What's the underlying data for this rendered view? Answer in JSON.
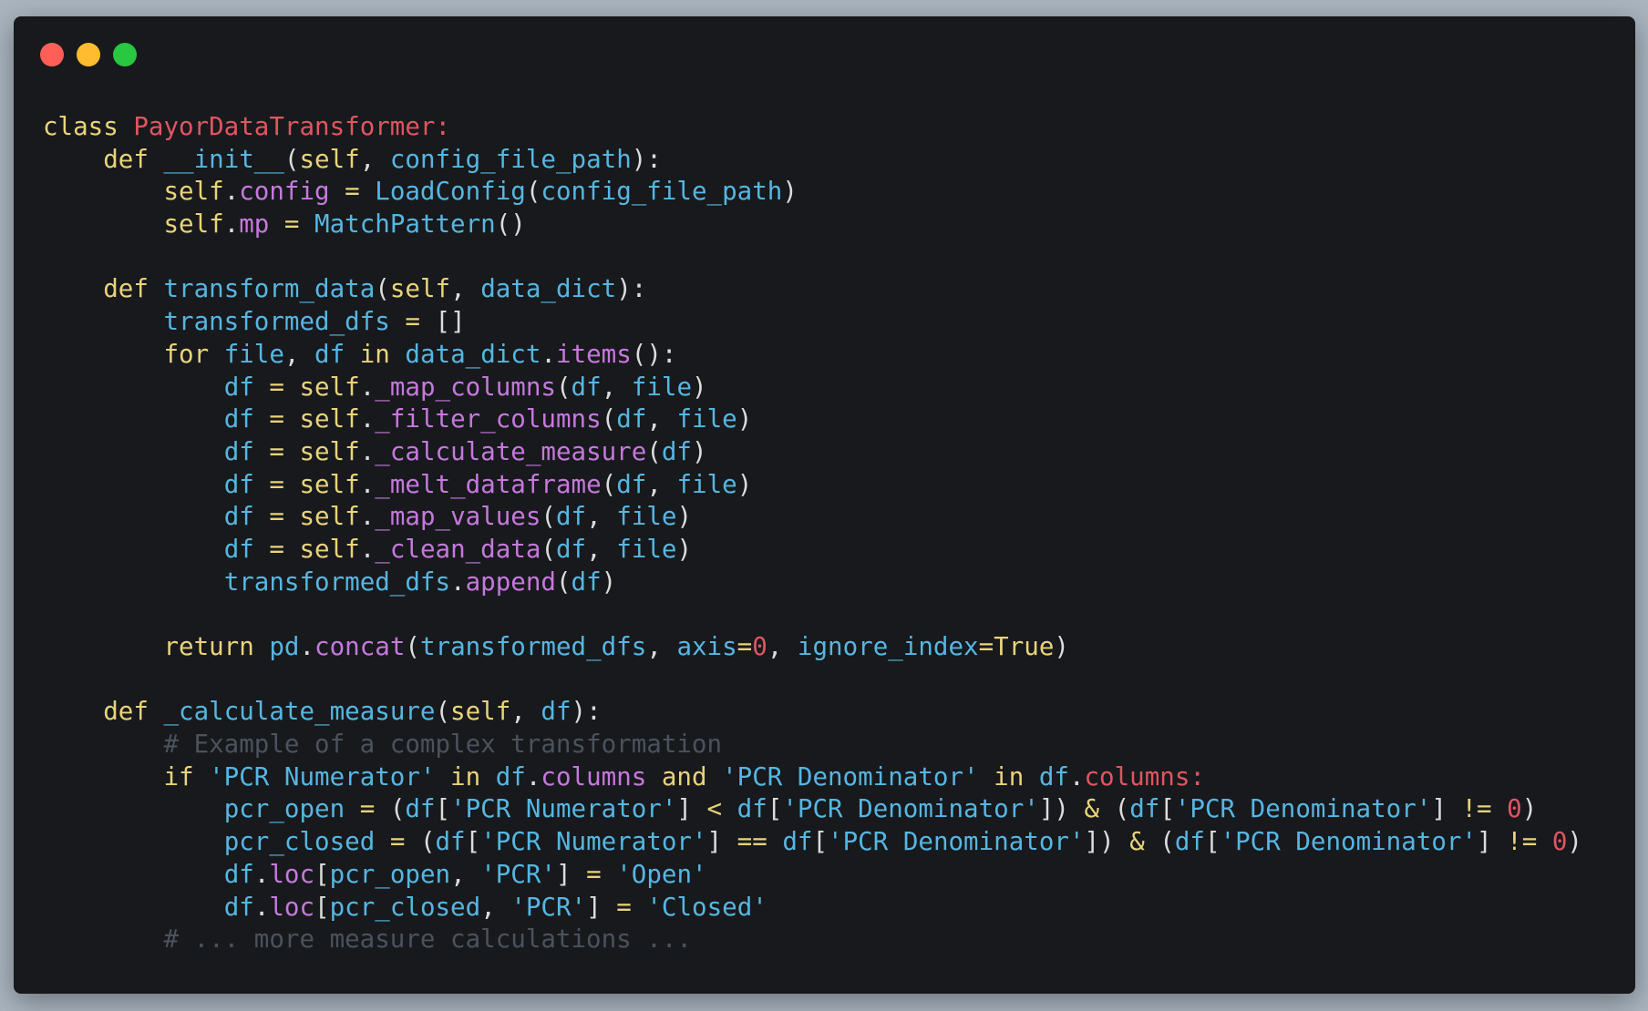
{
  "window": {
    "controls": [
      {
        "name": "close",
        "color": "#ff5f57"
      },
      {
        "name": "minimize",
        "color": "#febc2e"
      },
      {
        "name": "maximize",
        "color": "#28c840"
      }
    ]
  },
  "theme": {
    "keyword": "#e9d37a",
    "class_name": "#e05561",
    "function": "#56b6e2",
    "identifier": "#56b6e2",
    "attribute": "#c678dd",
    "punctuation": "#dcdcdc",
    "operator": "#e9d37a",
    "string": "#56b6e2",
    "number": "#e05561",
    "comment": "#4b525d",
    "default": "#e6e6e6"
  },
  "code_lines": [
    {
      "indent": 0,
      "tokens": [
        [
          "class ",
          "keyword"
        ],
        [
          "PayorDataTransformer:",
          "class_name"
        ]
      ]
    },
    {
      "indent": 4,
      "tokens": [
        [
          "def ",
          "keyword"
        ],
        [
          "__init__",
          "function"
        ],
        [
          "(",
          "punctuation"
        ],
        [
          "self",
          "keyword"
        ],
        [
          ", ",
          "punctuation"
        ],
        [
          "config_file_path",
          "identifier"
        ],
        [
          "):",
          "punctuation"
        ]
      ]
    },
    {
      "indent": 8,
      "tokens": [
        [
          "self",
          "keyword"
        ],
        [
          ".",
          "punctuation"
        ],
        [
          "config",
          "attribute"
        ],
        [
          " = ",
          "operator"
        ],
        [
          "LoadConfig",
          "function"
        ],
        [
          "(",
          "punctuation"
        ],
        [
          "config_file_path",
          "identifier"
        ],
        [
          ")",
          "punctuation"
        ]
      ]
    },
    {
      "indent": 8,
      "tokens": [
        [
          "self",
          "keyword"
        ],
        [
          ".",
          "punctuation"
        ],
        [
          "mp",
          "attribute"
        ],
        [
          " = ",
          "operator"
        ],
        [
          "MatchPattern",
          "function"
        ],
        [
          "()",
          "punctuation"
        ]
      ]
    },
    {
      "indent": 0,
      "tokens": []
    },
    {
      "indent": 4,
      "tokens": [
        [
          "def ",
          "keyword"
        ],
        [
          "transform_data",
          "function"
        ],
        [
          "(",
          "punctuation"
        ],
        [
          "self",
          "keyword"
        ],
        [
          ", ",
          "punctuation"
        ],
        [
          "data_dict",
          "identifier"
        ],
        [
          "):",
          "punctuation"
        ]
      ]
    },
    {
      "indent": 8,
      "tokens": [
        [
          "transformed_dfs",
          "identifier"
        ],
        [
          " = ",
          "operator"
        ],
        [
          "[]",
          "punctuation"
        ]
      ]
    },
    {
      "indent": 8,
      "tokens": [
        [
          "for ",
          "keyword"
        ],
        [
          "file",
          "identifier"
        ],
        [
          ", ",
          "punctuation"
        ],
        [
          "df",
          "identifier"
        ],
        [
          " in ",
          "keyword"
        ],
        [
          "data_dict",
          "identifier"
        ],
        [
          ".",
          "punctuation"
        ],
        [
          "items",
          "attribute"
        ],
        [
          "():",
          "punctuation"
        ]
      ]
    },
    {
      "indent": 12,
      "tokens": [
        [
          "df",
          "identifier"
        ],
        [
          " = ",
          "operator"
        ],
        [
          "self",
          "keyword"
        ],
        [
          ".",
          "punctuation"
        ],
        [
          "_map_columns",
          "attribute"
        ],
        [
          "(",
          "punctuation"
        ],
        [
          "df",
          "identifier"
        ],
        [
          ", ",
          "punctuation"
        ],
        [
          "file",
          "identifier"
        ],
        [
          ")",
          "punctuation"
        ]
      ]
    },
    {
      "indent": 12,
      "tokens": [
        [
          "df",
          "identifier"
        ],
        [
          " = ",
          "operator"
        ],
        [
          "self",
          "keyword"
        ],
        [
          ".",
          "punctuation"
        ],
        [
          "_filter_columns",
          "attribute"
        ],
        [
          "(",
          "punctuation"
        ],
        [
          "df",
          "identifier"
        ],
        [
          ", ",
          "punctuation"
        ],
        [
          "file",
          "identifier"
        ],
        [
          ")",
          "punctuation"
        ]
      ]
    },
    {
      "indent": 12,
      "tokens": [
        [
          "df",
          "identifier"
        ],
        [
          " = ",
          "operator"
        ],
        [
          "self",
          "keyword"
        ],
        [
          ".",
          "punctuation"
        ],
        [
          "_calculate_measure",
          "attribute"
        ],
        [
          "(",
          "punctuation"
        ],
        [
          "df",
          "identifier"
        ],
        [
          ")",
          "punctuation"
        ]
      ]
    },
    {
      "indent": 12,
      "tokens": [
        [
          "df",
          "identifier"
        ],
        [
          " = ",
          "operator"
        ],
        [
          "self",
          "keyword"
        ],
        [
          ".",
          "punctuation"
        ],
        [
          "_melt_dataframe",
          "attribute"
        ],
        [
          "(",
          "punctuation"
        ],
        [
          "df",
          "identifier"
        ],
        [
          ", ",
          "punctuation"
        ],
        [
          "file",
          "identifier"
        ],
        [
          ")",
          "punctuation"
        ]
      ]
    },
    {
      "indent": 12,
      "tokens": [
        [
          "df",
          "identifier"
        ],
        [
          " = ",
          "operator"
        ],
        [
          "self",
          "keyword"
        ],
        [
          ".",
          "punctuation"
        ],
        [
          "_map_values",
          "attribute"
        ],
        [
          "(",
          "punctuation"
        ],
        [
          "df",
          "identifier"
        ],
        [
          ", ",
          "punctuation"
        ],
        [
          "file",
          "identifier"
        ],
        [
          ")",
          "punctuation"
        ]
      ]
    },
    {
      "indent": 12,
      "tokens": [
        [
          "df",
          "identifier"
        ],
        [
          " = ",
          "operator"
        ],
        [
          "self",
          "keyword"
        ],
        [
          ".",
          "punctuation"
        ],
        [
          "_clean_data",
          "attribute"
        ],
        [
          "(",
          "punctuation"
        ],
        [
          "df",
          "identifier"
        ],
        [
          ", ",
          "punctuation"
        ],
        [
          "file",
          "identifier"
        ],
        [
          ")",
          "punctuation"
        ]
      ]
    },
    {
      "indent": 12,
      "tokens": [
        [
          "transformed_dfs",
          "identifier"
        ],
        [
          ".",
          "punctuation"
        ],
        [
          "append",
          "attribute"
        ],
        [
          "(",
          "punctuation"
        ],
        [
          "df",
          "identifier"
        ],
        [
          ")",
          "punctuation"
        ]
      ]
    },
    {
      "indent": 0,
      "tokens": []
    },
    {
      "indent": 8,
      "tokens": [
        [
          "return ",
          "keyword"
        ],
        [
          "pd",
          "identifier"
        ],
        [
          ".",
          "punctuation"
        ],
        [
          "concat",
          "attribute"
        ],
        [
          "(",
          "punctuation"
        ],
        [
          "transformed_dfs",
          "identifier"
        ],
        [
          ", ",
          "punctuation"
        ],
        [
          "axis",
          "identifier"
        ],
        [
          "=",
          "operator"
        ],
        [
          "0",
          "number"
        ],
        [
          ", ",
          "punctuation"
        ],
        [
          "ignore_index",
          "identifier"
        ],
        [
          "=",
          "operator"
        ],
        [
          "True",
          "keyword"
        ],
        [
          ")",
          "punctuation"
        ]
      ]
    },
    {
      "indent": 0,
      "tokens": []
    },
    {
      "indent": 4,
      "tokens": [
        [
          "def ",
          "keyword"
        ],
        [
          "_calculate_measure",
          "function"
        ],
        [
          "(",
          "punctuation"
        ],
        [
          "self",
          "keyword"
        ],
        [
          ", ",
          "punctuation"
        ],
        [
          "df",
          "identifier"
        ],
        [
          "):",
          "punctuation"
        ]
      ]
    },
    {
      "indent": 8,
      "tokens": [
        [
          "# Example of a complex transformation",
          "comment"
        ]
      ]
    },
    {
      "indent": 8,
      "tokens": [
        [
          "if ",
          "keyword"
        ],
        [
          "'PCR Numerator'",
          "string"
        ],
        [
          " in ",
          "keyword"
        ],
        [
          "df",
          "identifier"
        ],
        [
          ".",
          "punctuation"
        ],
        [
          "columns",
          "attribute"
        ],
        [
          " and ",
          "keyword"
        ],
        [
          "'PCR Denominator'",
          "string"
        ],
        [
          " in ",
          "keyword"
        ],
        [
          "df",
          "identifier"
        ],
        [
          ".",
          "punctuation"
        ],
        [
          "columns:",
          "class_name"
        ]
      ]
    },
    {
      "indent": 12,
      "tokens": [
        [
          "pcr_open",
          "identifier"
        ],
        [
          " = ",
          "operator"
        ],
        [
          "(",
          "punctuation"
        ],
        [
          "df",
          "identifier"
        ],
        [
          "[",
          "punctuation"
        ],
        [
          "'PCR Numerator'",
          "string"
        ],
        [
          "] ",
          "punctuation"
        ],
        [
          "<",
          "operator"
        ],
        [
          " ",
          "punctuation"
        ],
        [
          "df",
          "identifier"
        ],
        [
          "[",
          "punctuation"
        ],
        [
          "'PCR Denominator'",
          "string"
        ],
        [
          "]) ",
          "punctuation"
        ],
        [
          "&",
          "operator"
        ],
        [
          " (",
          "punctuation"
        ],
        [
          "df",
          "identifier"
        ],
        [
          "[",
          "punctuation"
        ],
        [
          "'PCR Denominator'",
          "string"
        ],
        [
          "] ",
          "punctuation"
        ],
        [
          "!=",
          "operator"
        ],
        [
          " ",
          "punctuation"
        ],
        [
          "0",
          "number"
        ],
        [
          ")",
          "punctuation"
        ]
      ]
    },
    {
      "indent": 12,
      "tokens": [
        [
          "pcr_closed",
          "identifier"
        ],
        [
          " = ",
          "operator"
        ],
        [
          "(",
          "punctuation"
        ],
        [
          "df",
          "identifier"
        ],
        [
          "[",
          "punctuation"
        ],
        [
          "'PCR Numerator'",
          "string"
        ],
        [
          "] ",
          "punctuation"
        ],
        [
          "==",
          "operator"
        ],
        [
          " ",
          "punctuation"
        ],
        [
          "df",
          "identifier"
        ],
        [
          "[",
          "punctuation"
        ],
        [
          "'PCR Denominator'",
          "string"
        ],
        [
          "]) ",
          "punctuation"
        ],
        [
          "&",
          "operator"
        ],
        [
          " (",
          "punctuation"
        ],
        [
          "df",
          "identifier"
        ],
        [
          "[",
          "punctuation"
        ],
        [
          "'PCR Denominator'",
          "string"
        ],
        [
          "] ",
          "punctuation"
        ],
        [
          "!=",
          "operator"
        ],
        [
          " ",
          "punctuation"
        ],
        [
          "0",
          "number"
        ],
        [
          ")",
          "punctuation"
        ]
      ]
    },
    {
      "indent": 12,
      "tokens": [
        [
          "df",
          "identifier"
        ],
        [
          ".",
          "punctuation"
        ],
        [
          "loc",
          "attribute"
        ],
        [
          "[",
          "punctuation"
        ],
        [
          "pcr_open",
          "identifier"
        ],
        [
          ", ",
          "punctuation"
        ],
        [
          "'PCR'",
          "string"
        ],
        [
          "] ",
          "punctuation"
        ],
        [
          "=",
          "operator"
        ],
        [
          " ",
          "punctuation"
        ],
        [
          "'Open'",
          "string"
        ]
      ]
    },
    {
      "indent": 12,
      "tokens": [
        [
          "df",
          "identifier"
        ],
        [
          ".",
          "punctuation"
        ],
        [
          "loc",
          "attribute"
        ],
        [
          "[",
          "punctuation"
        ],
        [
          "pcr_closed",
          "identifier"
        ],
        [
          ", ",
          "punctuation"
        ],
        [
          "'PCR'",
          "string"
        ],
        [
          "] ",
          "punctuation"
        ],
        [
          "=",
          "operator"
        ],
        [
          " ",
          "punctuation"
        ],
        [
          "'Closed'",
          "string"
        ]
      ]
    },
    {
      "indent": 8,
      "tokens": [
        [
          "# ... more measure calculations ...",
          "comment"
        ]
      ]
    }
  ]
}
